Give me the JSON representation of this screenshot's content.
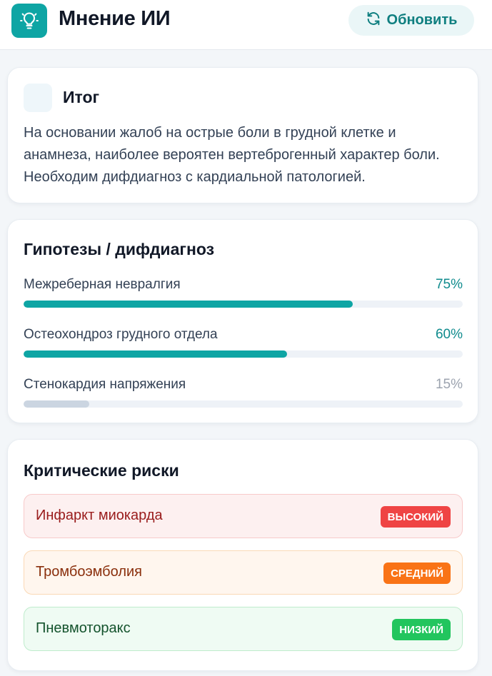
{
  "header": {
    "title": "Мнение ИИ",
    "refresh_label": "Обновить",
    "icons": {
      "logo": "lightbulb-icon",
      "refresh": "refresh-icon"
    }
  },
  "summary": {
    "title": "Итог",
    "text": "На основании жалоб на острые боли в грудной клетке и анамнеза, наиболее вероятен вертеброгенный характер боли. Необходим дифдиагноз с кардиальной патологией."
  },
  "hypotheses": {
    "title": "Гипотезы / дифдиагноз",
    "items": [
      {
        "label": "Межреберная невралгия",
        "percent_text": "75%",
        "value": 0.75,
        "color": "#0ea5a4",
        "text_color": "#0f8b8d"
      },
      {
        "label": "Остеохондроз грудного отдела",
        "percent_text": "60%",
        "value": 0.6,
        "color": "#0ea5a4",
        "text_color": "#0f8b8d"
      },
      {
        "label": "Стенокардия напряжения",
        "percent_text": "15%",
        "value": 0.15,
        "color": "#cbd5e1",
        "text_color": "#9ca3af"
      }
    ]
  },
  "risks": {
    "title": "Критические риски",
    "items": [
      {
        "label": "Инфаркт миокарда",
        "badge": "ВЫСОКИЙ",
        "bg": "#fdf0f0",
        "border": "#f8caca",
        "text": "#991b1b",
        "badge_bg": "#ef4444"
      },
      {
        "label": "Тромбоэмболия",
        "badge": "СРЕДНИЙ",
        "bg": "#fff6ee",
        "border": "#fbd9b6",
        "text": "#8a2f0c",
        "badge_bg": "#f97316"
      },
      {
        "label": "Пневмоторакс",
        "badge": "НИЗКИЙ",
        "bg": "#effbf3",
        "border": "#bfeccc",
        "text": "#14532d",
        "badge_bg": "#22c55e"
      }
    ]
  }
}
